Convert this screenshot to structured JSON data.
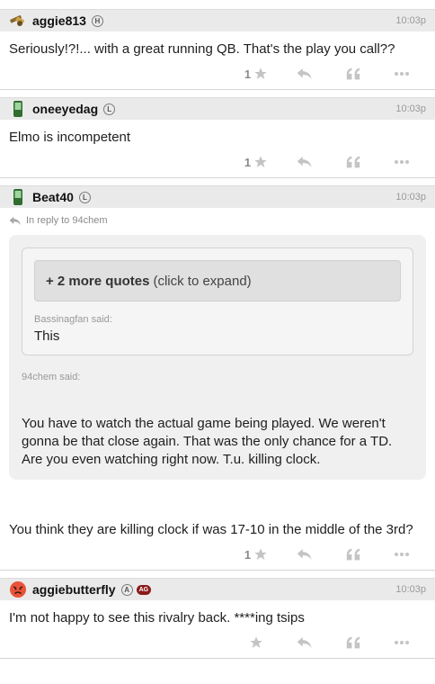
{
  "posts": [
    {
      "username": "aggie813",
      "badge": "H",
      "time": "10:03p",
      "body": "Seriously!?!... with a great running QB. That's the play you call??",
      "likes": "1"
    },
    {
      "username": "oneeyedag",
      "badge": "L",
      "time": "10:03p",
      "body": "Elmo is incompetent",
      "likes": "1"
    },
    {
      "username": "Beat40",
      "badge": "L",
      "time": "10:03p",
      "reply_to": "In reply to 94chem",
      "expand_count": "+ 2 more quotes",
      "expand_hint": "(click to expand)",
      "inner_author": "Bassinagfan said:",
      "inner_text": "This",
      "outer_author": "94chem said:",
      "outer_text": "You have to watch the actual game being played. We weren't gonna be that close again. That was the only chance for a TD. Are you even watching right now. T.u. killing clock.",
      "body": "You think they are killing clock if was 17-10 in the middle of the 3rd?",
      "likes": "1"
    },
    {
      "username": "aggiebutterfly",
      "badge": "A",
      "badge2": "AG",
      "time": "10:03p",
      "body": "I'm not happy to see this rivalry back. ****ing tsips",
      "likes": ""
    }
  ],
  "icons": [
    "shotgun-icon",
    "phone-icon",
    "angry-face-icon",
    "star-icon",
    "reply-arrow-icon",
    "quote-icon",
    "more-icon"
  ],
  "colors": {
    "header_bg": "#eaeaea",
    "quote_bg": "#f0f0f0",
    "badge_ag": "#8a1a1a"
  }
}
